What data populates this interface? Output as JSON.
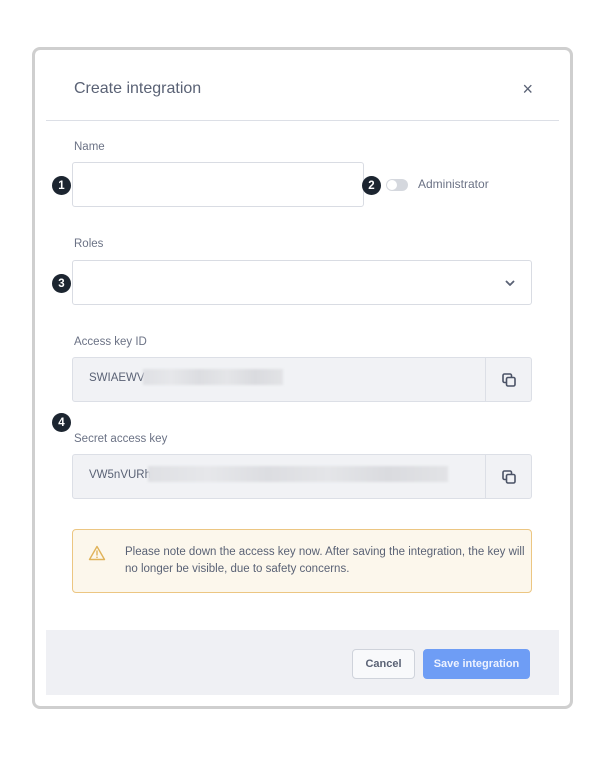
{
  "dialog": {
    "title": "Create integration",
    "close_icon": "×"
  },
  "form": {
    "name": {
      "label": "Name",
      "value": "",
      "placeholder": ""
    },
    "administrator": {
      "label": "Administrator",
      "checked": false
    },
    "roles": {
      "label": "Roles",
      "value": ""
    },
    "access_key_id": {
      "label": "Access key ID",
      "visible_prefix": "SWIAEWV",
      "redacted": true
    },
    "secret_access_key": {
      "label": "Secret access key",
      "visible_prefix": "VW5nVURh",
      "redacted": true
    }
  },
  "annotations": [
    "1",
    "2",
    "3",
    "4"
  ],
  "alert": {
    "type": "warning",
    "text": "Please note down the access key now. After saving the integration, the key will no longer be visible, due to safety concerns."
  },
  "footer": {
    "cancel_label": "Cancel",
    "save_label": "Save integration"
  },
  "colors": {
    "primary": "#6e9df5",
    "warning_border": "#ecc682",
    "warning_bg": "#fcf7ec",
    "badge": "#1c2530"
  }
}
